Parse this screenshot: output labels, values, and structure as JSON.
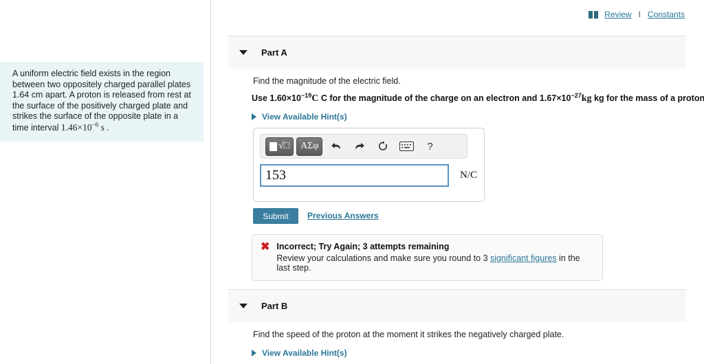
{
  "topbar": {
    "book_icon": "book-icon",
    "review_label": "Review",
    "separator": "I",
    "constants_label": "Constants"
  },
  "problem": {
    "text_before": "A uniform electric field exists in the region between two oppositely charged parallel plates 1.64 cm apart. A proton is released from rest at the surface of the positively charged plate and strikes the surface of the opposite plate in a time interval ",
    "time_mantissa": "1.46×10",
    "time_exponent": "−6",
    "time_unit": " s ."
  },
  "parts": {
    "a": {
      "caret": "chevron-down-icon",
      "title": "Part A",
      "question": "Find the magnitude of the electric field.",
      "instruction_1": "Use 1.60×10",
      "instruction_exp_1": "−19",
      "instruction_2": " C for the magnitude of the charge on an electron and 1.67×10",
      "instruction_exp_2": "−27",
      "instruction_3": " kg for the mass of a proton.",
      "hint_label": "View Available Hint(s)"
    },
    "b": {
      "caret": "chevron-down-icon",
      "title": "Part B",
      "question": "Find the speed of the proton at the moment it strikes the negatively charged plate.",
      "hint_label": "View Available Hint(s)"
    }
  },
  "answer": {
    "toolbar": {
      "template_button": "√□",
      "greek_button": "ΑΣφ",
      "undo_icon": "undo-arrow-icon",
      "redo_icon": "redo-arrow-icon",
      "reset_icon": "reset-circular-arrow-icon",
      "keyboard_icon": "keyboard-icon",
      "help_label": "?"
    },
    "value": "153",
    "placeholder": "",
    "unit": "N/C"
  },
  "actions": {
    "submit_label": "Submit",
    "previous_answers_label": "Previous Answers"
  },
  "feedback": {
    "status_icon": "✖",
    "title": "Incorrect; Try Again; 3 attempts remaining",
    "body_before": "Review your calculations and make sure you round to 3 ",
    "link": "significant figures",
    "body_after": " in the last step."
  },
  "colors": {
    "accent_link": "#2b7797",
    "submit_button": "#3a7d9e",
    "error": "#cc2026",
    "problem_background": "#e8f4f6"
  }
}
